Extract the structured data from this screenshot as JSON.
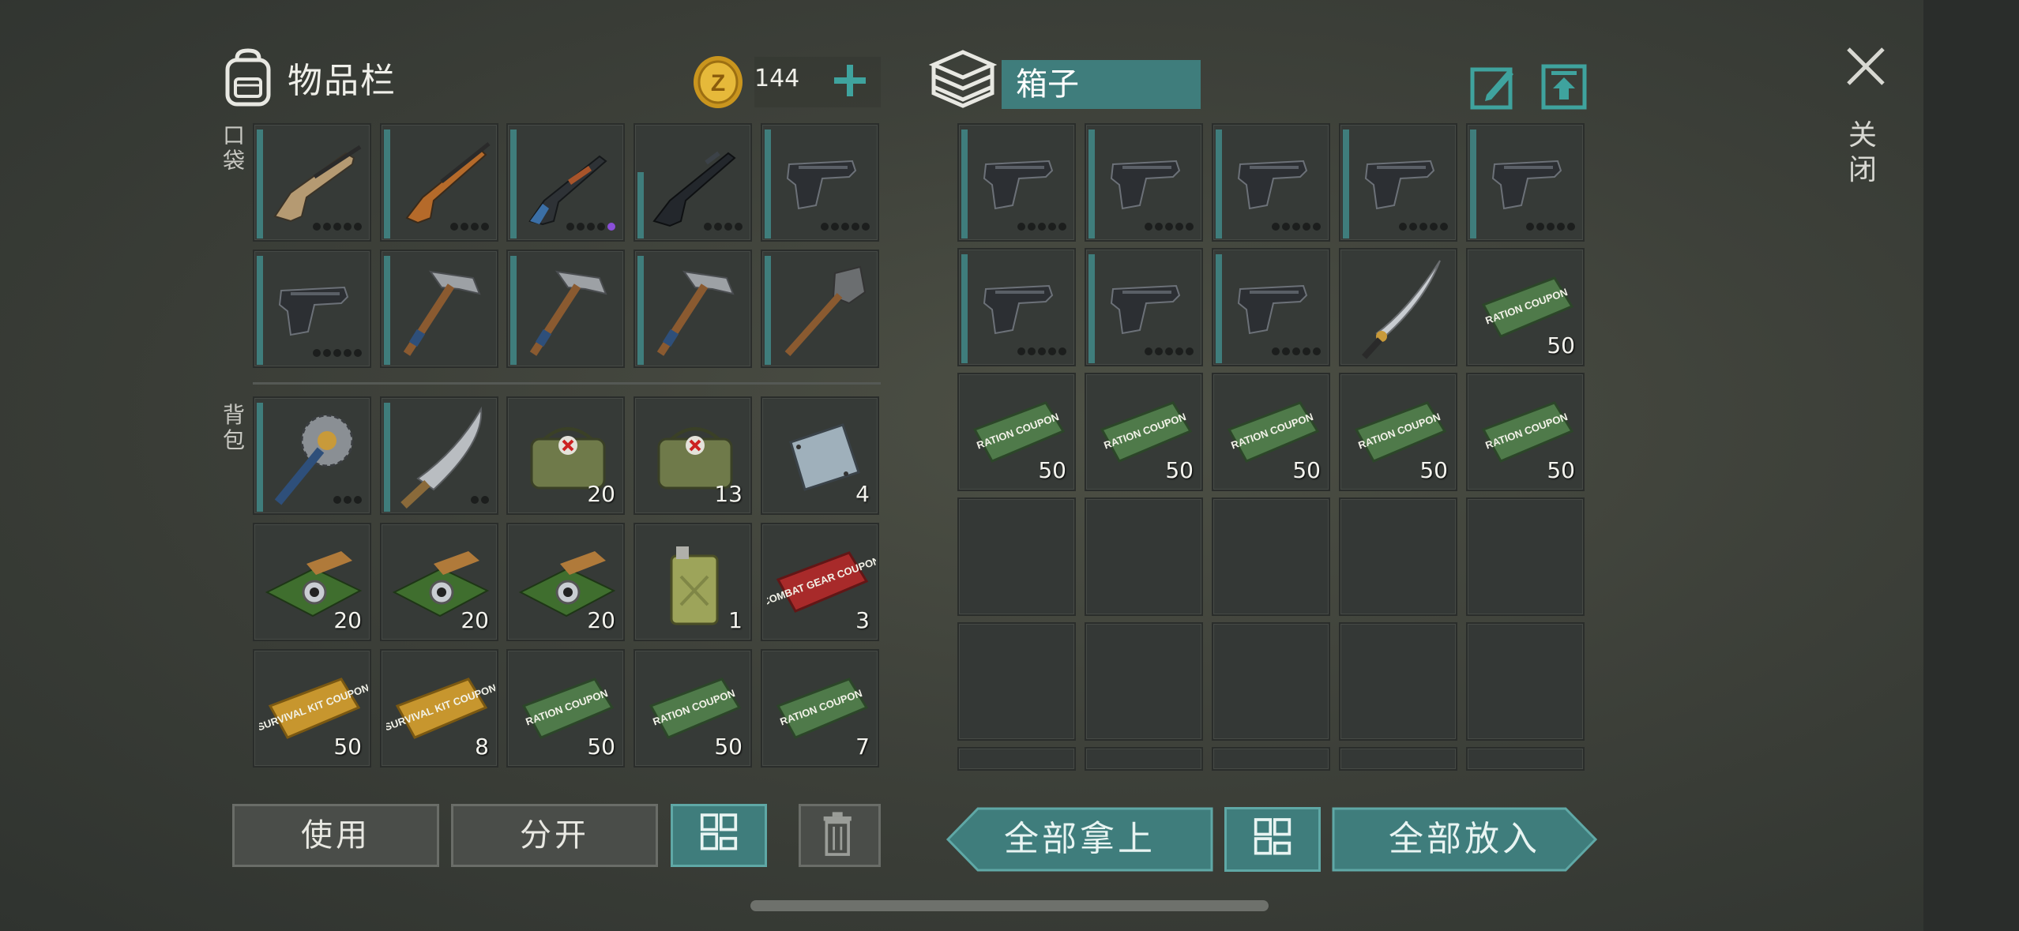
{
  "inventory": {
    "title": "物品栏",
    "coins": "144",
    "pocket_label": "口袋",
    "backpack_label": "背包",
    "pocket_items": [
      {
        "icon": "assault-rifle-scar-icon",
        "qty": "",
        "dots": 5,
        "durability": "full"
      },
      {
        "icon": "sniper-rifle-svd-icon",
        "qty": "",
        "dots": 4,
        "durability": "full"
      },
      {
        "icon": "ak-rifle-icon",
        "qty": "",
        "dots": 5,
        "purple": true,
        "durability": "full"
      },
      {
        "icon": "m16-rifle-icon",
        "qty": "",
        "dots": 4,
        "durability": "partial"
      },
      {
        "icon": "pistol-icon",
        "qty": "",
        "dots": 5,
        "durability": "full"
      },
      {
        "icon": "pistol-icon",
        "qty": "",
        "dots": 5,
        "durability": "full"
      },
      {
        "icon": "pickaxe-icon",
        "qty": "",
        "dots": 0,
        "durability": "full"
      },
      {
        "icon": "pickaxe-icon",
        "qty": "",
        "dots": 0,
        "durability": "full"
      },
      {
        "icon": "pickaxe-icon",
        "qty": "",
        "dots": 0,
        "durability": "full"
      },
      {
        "icon": "shovel-icon",
        "qty": "",
        "dots": 0,
        "durability": "full"
      }
    ],
    "backpack_items": [
      {
        "icon": "saw-mace-icon",
        "qty": "",
        "dots": 3
      },
      {
        "icon": "machete-icon",
        "qty": "",
        "dots": 2
      },
      {
        "icon": "medkit-bag-icon",
        "qty": "20"
      },
      {
        "icon": "medkit-bag-icon",
        "qty": "13"
      },
      {
        "icon": "metal-plate-icon",
        "qty": "4"
      },
      {
        "icon": "circuit-board-icon",
        "qty": "20"
      },
      {
        "icon": "circuit-board-icon",
        "qty": "20"
      },
      {
        "icon": "circuit-board-icon",
        "qty": "20"
      },
      {
        "icon": "fuel-can-icon",
        "qty": "1"
      },
      {
        "icon": "combat-gear-coupon-icon",
        "qty": "3",
        "text": "COMBAT GEAR COUPON"
      },
      {
        "icon": "survival-kit-coupon-icon",
        "qty": "50",
        "text": "SURVIVAL KIT COUPON"
      },
      {
        "icon": "survival-kit-coupon-icon",
        "qty": "8",
        "text": "SURVIVAL KIT COUPON"
      },
      {
        "icon": "ration-coupon-icon",
        "qty": "50",
        "text": "RATION COUPON"
      },
      {
        "icon": "ration-coupon-icon",
        "qty": "50",
        "text": "RATION COUPON"
      },
      {
        "icon": "ration-coupon-icon",
        "qty": "7",
        "text": "RATION COUPON"
      }
    ],
    "buttons": {
      "use": "使用",
      "split": "分开"
    }
  },
  "box": {
    "title": "箱子",
    "items": [
      {
        "icon": "pistol-icon",
        "qty": "",
        "dots": 5
      },
      {
        "icon": "pistol-icon",
        "qty": "",
        "dots": 5
      },
      {
        "icon": "pistol-icon",
        "qty": "",
        "dots": 5
      },
      {
        "icon": "pistol-icon",
        "qty": "",
        "dots": 5
      },
      {
        "icon": "pistol-icon",
        "qty": "",
        "dots": 5
      },
      {
        "icon": "pistol-icon",
        "qty": "",
        "dots": 5
      },
      {
        "icon": "pistol-icon",
        "qty": "",
        "dots": 5
      },
      {
        "icon": "pistol-icon",
        "qty": "",
        "dots": 5
      },
      {
        "icon": "katana-icon",
        "qty": ""
      },
      {
        "icon": "ration-coupon-icon",
        "qty": "50",
        "text": "RATION COUPON"
      },
      {
        "icon": "ration-coupon-icon",
        "qty": "50",
        "text": "RATION COUPON"
      },
      {
        "icon": "ration-coupon-icon",
        "qty": "50",
        "text": "RATION COUPON"
      },
      {
        "icon": "ration-coupon-icon",
        "qty": "50",
        "text": "RATION COUPON"
      },
      {
        "icon": "ration-coupon-icon",
        "qty": "50",
        "text": "RATION COUPON"
      },
      {
        "icon": "ration-coupon-icon",
        "qty": "50",
        "text": "RATION COUPON"
      }
    ],
    "empty_slots": 10,
    "buttons": {
      "take_all": "全部拿上",
      "put_all": "全部放入"
    }
  },
  "close_label": "关闭",
  "colors": {
    "teal": "#3f7d7c",
    "teal_light": "#5fa8a6",
    "slot_bg": "#363a37"
  }
}
